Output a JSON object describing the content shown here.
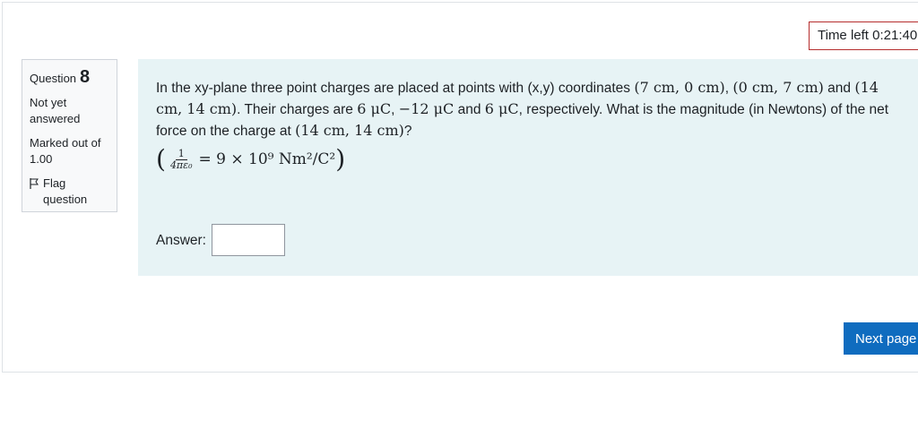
{
  "timer": {
    "label": "Time left",
    "value": "0:21:40"
  },
  "question_info": {
    "label": "Question",
    "number": "8",
    "state": "Not yet answered",
    "grade": "Marked out of 1.00",
    "flag_label": "Flag question"
  },
  "question": {
    "text_part1": "In the xy-plane three point charges are placed at points with (x,y) coordinates ",
    "coord1": "(7 cm, 0 cm)",
    "sep1": ", ",
    "coord2": "(0 cm, 7 cm)",
    "text_and": " and ",
    "coord3": "(14 cm, 14 cm)",
    "text_charges": ". Their charges are ",
    "charge1": "6 μC",
    "sep2": ", ",
    "charge2": "−12 μC",
    "text_and2": " and ",
    "charge3": "6 μC",
    "text_part2": ", respectively. What is the magnitude (in Newtons) of the net force on the charge at ",
    "coord_target": "(14 cm, 14 cm)",
    "text_end": "?",
    "formula_frac_num": "1",
    "formula_frac_den": "4πε₀",
    "formula_rhs": "= 9 × 10⁹ Nm²/C²"
  },
  "answer": {
    "label": "Answer:",
    "value": ""
  },
  "navigation": {
    "next_label": "Next page"
  }
}
